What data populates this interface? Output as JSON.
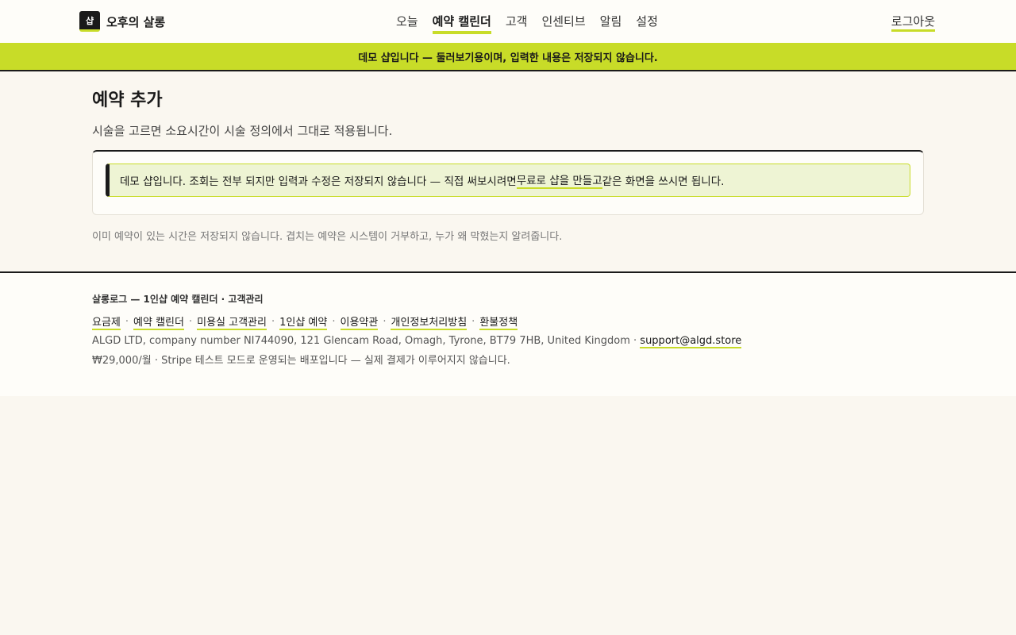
{
  "brand": {
    "logo_text": "샵",
    "name": "오후의 살롱"
  },
  "nav": {
    "items": [
      {
        "label": "오늘"
      },
      {
        "label": "예약 캘린더",
        "active": true
      },
      {
        "label": "고객"
      },
      {
        "label": "인센티브"
      },
      {
        "label": "알림"
      },
      {
        "label": "설정"
      }
    ],
    "logout_label": "로그아웃"
  },
  "banner": {
    "text": "데모 샵입니다 — 둘러보기용이며, 입력한 내용은 저장되지 않습니다."
  },
  "page": {
    "title": "예약 추가",
    "subtitle": "시술을 고르면 소요시간이 시술 정의에서 그대로 적용됩니다."
  },
  "notice": {
    "text_before": "데모 샵입니다. 조회는 전부 되지만 입력과 수정은 저장되지 않습니다 — 직접 써보시려면 ",
    "link_label": "무료로 샵을 만들고",
    "text_after": " 같은 화면을 쓰시면 됩니다."
  },
  "hint": "이미 예약이 있는 시간은 저장되지 않습니다. 겹치는 예약은 시스템이 거부하고, 누가 왜 막혔는지 알려줍니다.",
  "footer": {
    "title": "살롱로그 — 1인샵 예약 캘린더 · 고객관리",
    "links": [
      "요금제",
      "예약 캘린더",
      "미용실 고객관리",
      "1인샵 예약",
      "이용약관",
      "개인정보처리방침",
      "환불정책"
    ],
    "separator": "·",
    "company_text": "ALGD LTD, company number NI744090, 121 Glencam Road, Omagh, Tyrone, BT79 7HB, United Kingdom · ",
    "support_email": "support@algd.store",
    "pricing_text": "₩29,000/월 · Stripe 테스트 모드로 운영되는 배포입니다 — 실제 결제가 이루어지지 않습니다."
  },
  "colors": {
    "accent": "#c8dc28",
    "background": "#faf7f0",
    "text": "#1a1a1a"
  }
}
